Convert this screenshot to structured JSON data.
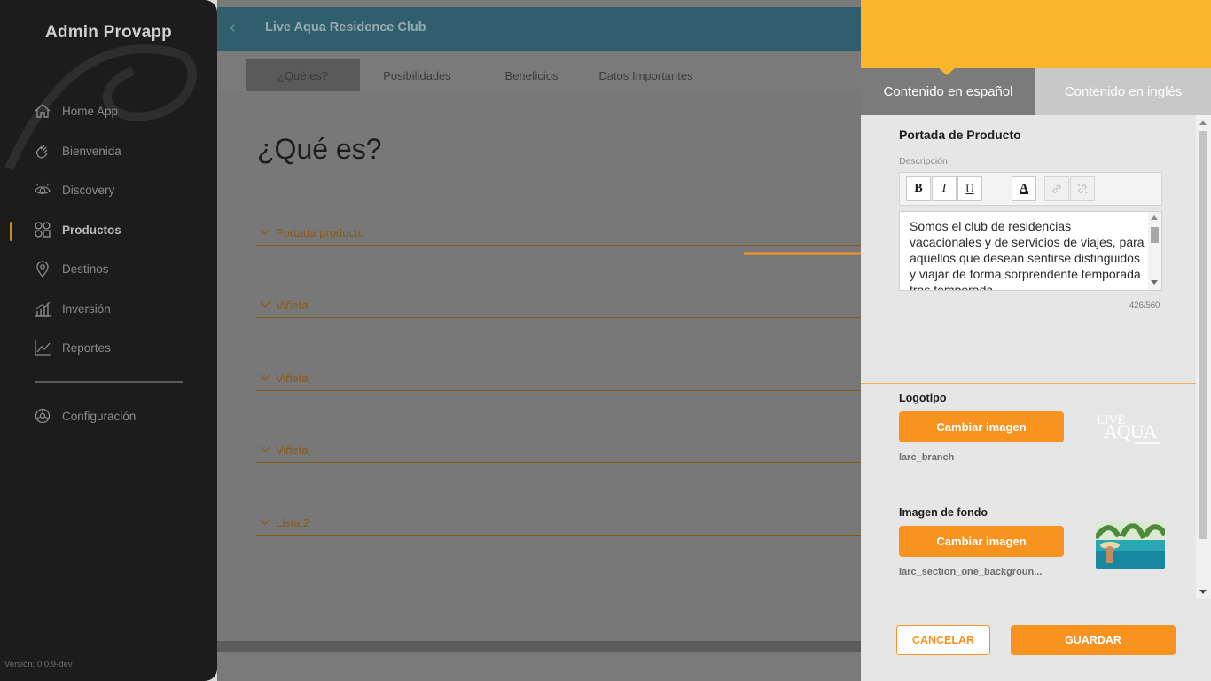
{
  "sidebar": {
    "brand": "Admin Provapp",
    "items": [
      {
        "label": "Home App",
        "icon": "home-icon"
      },
      {
        "label": "Bienvenida",
        "icon": "wave-hand-icon"
      },
      {
        "label": "Discovery",
        "icon": "eye-icon"
      },
      {
        "label": "Productos",
        "icon": "grid-icon",
        "active": true
      },
      {
        "label": "Destinos",
        "icon": "map-pin-icon"
      },
      {
        "label": "Inversión",
        "icon": "bar-chart-icon"
      },
      {
        "label": "Reportes",
        "icon": "line-chart-icon"
      }
    ],
    "settings_label": "Configuración",
    "version": "Versión: 0.0.9-dev"
  },
  "main": {
    "title": "Live Aqua Residence Club",
    "tabs": [
      {
        "label": "¿Qué es?",
        "active": true
      },
      {
        "label": "Posibilidades"
      },
      {
        "label": "Beneficios"
      },
      {
        "label": "Datos Importantes"
      }
    ],
    "heading": "¿Qué es?",
    "accordions": [
      {
        "label": "Portada producto"
      },
      {
        "label": "Viñeta"
      },
      {
        "label": "Viñeta"
      },
      {
        "label": "Viñeta"
      },
      {
        "label": "Lista 2"
      }
    ]
  },
  "panel": {
    "lang_tabs": [
      {
        "label": "Contenido en español",
        "active": true
      },
      {
        "label": "Contenido en inglés"
      }
    ],
    "section_title": "Portada de Producto",
    "description_label": "Descripción",
    "toolbar": {
      "bold": "B",
      "italic": "I",
      "underline": "U",
      "font_color": "A"
    },
    "description_text": "Somos el club de residencias vacacionales y de servicios de viajes, para aquellos que desean sentirse distinguidos y viajar de forma sorprendente temporada tras temporada.",
    "char_counter": "426/560",
    "logo": {
      "title": "Logotipo",
      "button": "Cambiar imagen",
      "file": "larc_branch",
      "thumb_text_1": "LIVE",
      "thumb_text_2": "AQUA"
    },
    "background": {
      "title": "Imagen de fondo",
      "button": "Cambiar imagen",
      "file": "larc_section_one_backgroun..."
    },
    "cancel_label": "CANCELAR",
    "save_label": "GUARDAR"
  },
  "colors": {
    "accent": "#f7931e",
    "header_yellow": "#f9b52c",
    "sidebar_bg": "#1c1c1c",
    "topbar_teal": "#2f5e6d"
  }
}
